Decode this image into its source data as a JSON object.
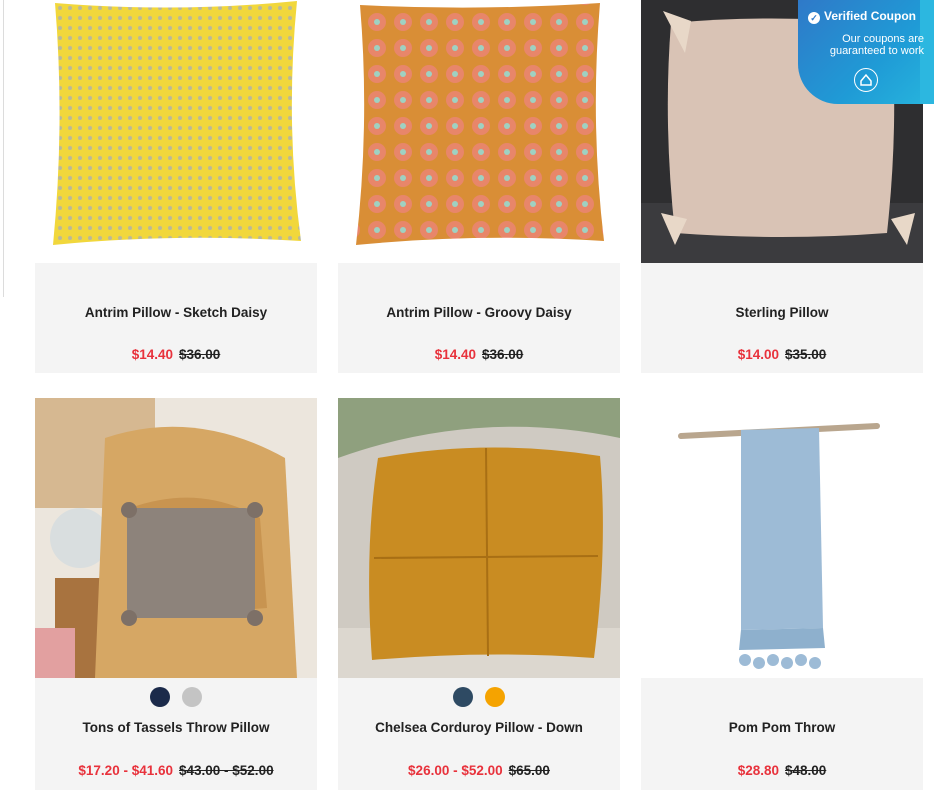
{
  "coupon": {
    "title": "Verified Coupon",
    "subtitle_line1": "Our coupons are",
    "subtitle_line2": "guaranteed to work"
  },
  "products": [
    {
      "title": "Antrim Pillow - Sketch Daisy",
      "sale_price": "$14.40",
      "original_price": "$36.00"
    },
    {
      "title": "Antrim Pillow - Groovy Daisy",
      "sale_price": "$14.40",
      "original_price": "$36.00"
    },
    {
      "title": "Sterling Pillow",
      "sale_price": "$14.00",
      "original_price": "$35.00"
    },
    {
      "title": "Tons of Tassels Throw Pillow",
      "sale_price": "$17.20 - $41.60",
      "original_price": "$43.00 - $52.00",
      "swatches": [
        "#1b2a4a",
        "#c4c4c4"
      ]
    },
    {
      "title": "Chelsea Corduroy Pillow - Down",
      "sale_price": "$26.00 - $52.00",
      "original_price": "$65.00",
      "swatches": [
        "#2e4a63",
        "#f5a300"
      ]
    },
    {
      "title": "Pom Pom Throw",
      "sale_price": "$28.80",
      "original_price": "$48.00"
    }
  ],
  "colors": {
    "sale": "#e8323c",
    "card_bg": "#f4f4f4",
    "coupon": "#2f79c8"
  }
}
